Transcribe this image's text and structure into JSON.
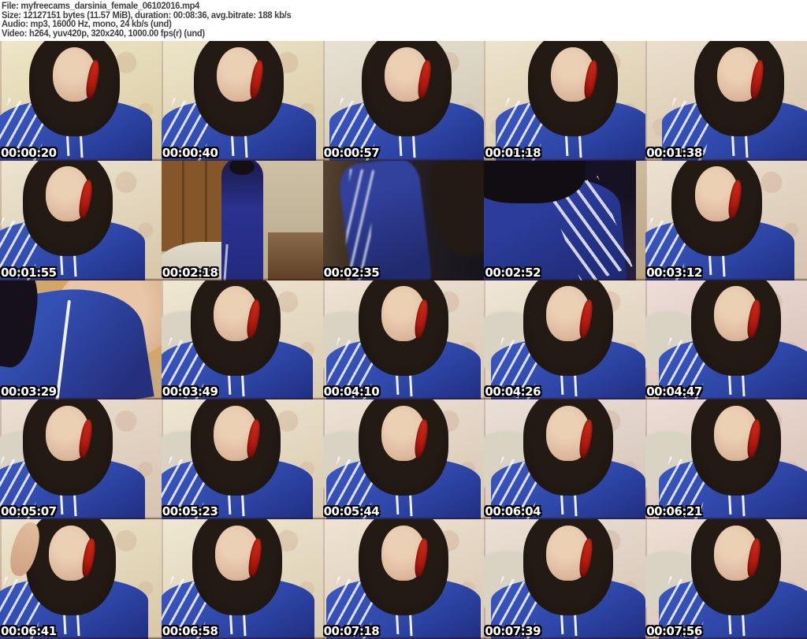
{
  "header": {
    "lines": [
      "File: myfreecams_darsinia_female_06102016.mp4",
      "Size: 12127151 bytes (11.57 MiB), duration: 00:08:36, avg.bitrate: 188 kb/s",
      "Audio: mp3, 16000 Hz, mono, 24 kb/s (und)",
      "Video: h264, yuv420p, 320x240, 1000.00 fps(r) (und)"
    ]
  },
  "colors": {
    "page_bg": "#ffffff",
    "header_text": "#3f3f3f",
    "timestamp_text": "#ffffff",
    "timestamp_outline": "#000000",
    "jacket_blue": "#2e47a8",
    "hair_dark": "#17110d",
    "skin": "#dcb79c",
    "phone_red": "#b21b10",
    "wall_yellow": "#e8dcb2",
    "wall_pink": "#e4d2c6",
    "pillow": "#d8d3c3"
  },
  "grid": {
    "columns": 5,
    "rows": 5,
    "thumbnails": [
      {
        "t": "00:00:20",
        "v": "portrait",
        "fx": 46,
        "wall": "#e8dcb2",
        "scene": "close-up, phone to ear, face left of center"
      },
      {
        "t": "00:00:40",
        "v": "portrait",
        "fx": 48,
        "wall": "#e6dab4",
        "scene": "close-up, phone to ear"
      },
      {
        "t": "00:00:57",
        "v": "portrait",
        "fx": 52,
        "wall": "#ddd6c2",
        "scene": "close-up, phone to ear"
      },
      {
        "t": "00:01:18",
        "v": "portrait",
        "fx": 55,
        "wall": "#e6d8b8",
        "scene": "close-up, phone to ear"
      },
      {
        "t": "00:01:38",
        "v": "portrait",
        "fx": 58,
        "wall": "#e3d2b8",
        "scene": "close-up, phone to ear, face right"
      },
      {
        "t": "00:01:55",
        "v": "portrait",
        "fx": 42,
        "wall": "#e6d9bc",
        "scene": "close-up, phone to ear, face left"
      },
      {
        "t": "00:02:18",
        "v": "fullbody",
        "wall": "#c9bca2",
        "scene": "full-body standing in bedroom, wardrobe and bed"
      },
      {
        "t": "00:02:35",
        "v": "darkblur",
        "scene": "dark motion-blurred close-up of jacket"
      },
      {
        "t": "00:02:52",
        "v": "jacketdark",
        "scene": "jacket close-up with stripes, dark background"
      },
      {
        "t": "00:03:12",
        "v": "portrait",
        "fx": 44,
        "wall": "#e5d5c0",
        "scene": "close-up, phone to ear"
      },
      {
        "t": "00:03:29",
        "v": "jacketneck",
        "scene": "extreme close-up of jacket and neckline"
      },
      {
        "t": "00:03:49",
        "v": "portrait",
        "fx": 46,
        "pillow": true,
        "wall": "#e9ddc2",
        "scene": "close-up with pillow at left"
      },
      {
        "t": "00:04:10",
        "v": "portrait",
        "fx": 50,
        "pillow": true,
        "wall": "#e7d8c4",
        "scene": "close-up, head tilted down"
      },
      {
        "t": "00:04:26",
        "v": "portrait",
        "fx": 52,
        "pillow": true,
        "wall": "#e9dcc6",
        "scene": "close-up with pillow at left"
      },
      {
        "t": "00:04:47",
        "v": "portrait",
        "fx": 56,
        "pillow": true,
        "wall": "#e6cfc8",
        "scene": "close-up, pink floral wallpaper"
      },
      {
        "t": "00:05:07",
        "v": "portrait",
        "fx": 42,
        "pillow": true,
        "wall": "#e5d4c2",
        "scene": "close-up smiling, face left"
      },
      {
        "t": "00:05:23",
        "v": "portrait",
        "fx": 46,
        "pillow": true,
        "wall": "#e8dcc0",
        "scene": "close-up smiling"
      },
      {
        "t": "00:05:44",
        "v": "portrait",
        "fx": 50,
        "pillow": true,
        "wall": "#e6d6c4",
        "scene": "close-up, phone to ear"
      },
      {
        "t": "00:06:04",
        "v": "portrait",
        "fx": 52,
        "pillow": true,
        "wall": "#e2d3c8",
        "scene": "close-up, phone to ear"
      },
      {
        "t": "00:06:21",
        "v": "portrait",
        "fx": 56,
        "pillow": true,
        "wall": "#e6d0c6",
        "scene": "close-up smiling, face right"
      },
      {
        "t": "00:06:41",
        "v": "portrait",
        "fx": 44,
        "hand": true,
        "wall": "#e7dab8",
        "scene": "close-up, hand raised near face"
      },
      {
        "t": "00:06:58",
        "v": "portrait",
        "fx": 47,
        "wall": "#e9dec0",
        "scene": "close-up, head lowered"
      },
      {
        "t": "00:07:18",
        "v": "portrait",
        "fx": 50,
        "wall": "#e8d8c2",
        "scene": "close-up, phone to ear"
      },
      {
        "t": "00:07:39",
        "v": "portrait",
        "fx": 52,
        "pillow": true,
        "wall": "#e4d4c6",
        "scene": "close-up, phone to ear"
      },
      {
        "t": "00:07:56",
        "v": "portrait",
        "fx": 56,
        "pillow": true,
        "wall": "#e7d2c4",
        "scene": "close-up smiling, phone to ear"
      }
    ]
  }
}
